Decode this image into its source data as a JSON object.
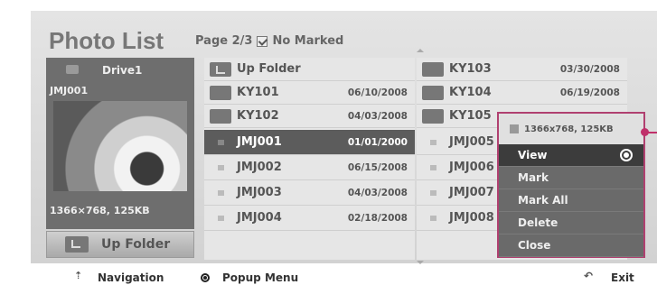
{
  "header": {
    "title": "Photo List",
    "page_info": "Page 2/3",
    "marked_status": "No Marked"
  },
  "preview": {
    "drive": "Drive1",
    "file_name": "JMJ001",
    "file_info": "1366×768, 125KB"
  },
  "up_folder_button": "Up Folder",
  "columns": [
    {
      "rows": [
        {
          "icon": "up-folder-icon",
          "name": "Up Folder",
          "date": ""
        },
        {
          "icon": "folder-icon",
          "name": "KY101",
          "date": "06/10/2008"
        },
        {
          "icon": "folder-icon",
          "name": "KY102",
          "date": "04/03/2008"
        },
        {
          "icon": "file-icon",
          "name": "JMJ001",
          "date": "01/01/2000",
          "selected": true
        },
        {
          "icon": "file-icon",
          "name": "JMJ002",
          "date": "06/15/2008"
        },
        {
          "icon": "file-icon",
          "name": "JMJ003",
          "date": "04/03/2008"
        },
        {
          "icon": "file-icon",
          "name": "JMJ004",
          "date": "02/18/2008"
        }
      ]
    },
    {
      "rows": [
        {
          "icon": "folder-icon",
          "name": "KY103",
          "date": "03/30/2008"
        },
        {
          "icon": "folder-icon",
          "name": "KY104",
          "date": "06/19/2008"
        },
        {
          "icon": "folder-icon",
          "name": "KY105",
          "date": ""
        },
        {
          "icon": "file-icon",
          "name": "JMJ005",
          "date": ""
        },
        {
          "icon": "file-icon",
          "name": "JMJ006",
          "date": ""
        },
        {
          "icon": "file-icon",
          "name": "JMJ007",
          "date": ""
        },
        {
          "icon": "file-icon",
          "name": "JMJ008",
          "date": ""
        }
      ]
    }
  ],
  "popup": {
    "header": "1366x768, 125KB",
    "items": [
      {
        "label": "View",
        "selected": true
      },
      {
        "label": "Mark"
      },
      {
        "label": "Mark All"
      },
      {
        "label": "Delete"
      },
      {
        "label": "Close"
      }
    ]
  },
  "footer": {
    "navigation": "Navigation",
    "popup_menu": "Popup Menu",
    "exit": "Exit"
  },
  "colors": {
    "accent": "#c0306a",
    "selection": "#5c5c5c",
    "panel": "#6e6e6e"
  }
}
